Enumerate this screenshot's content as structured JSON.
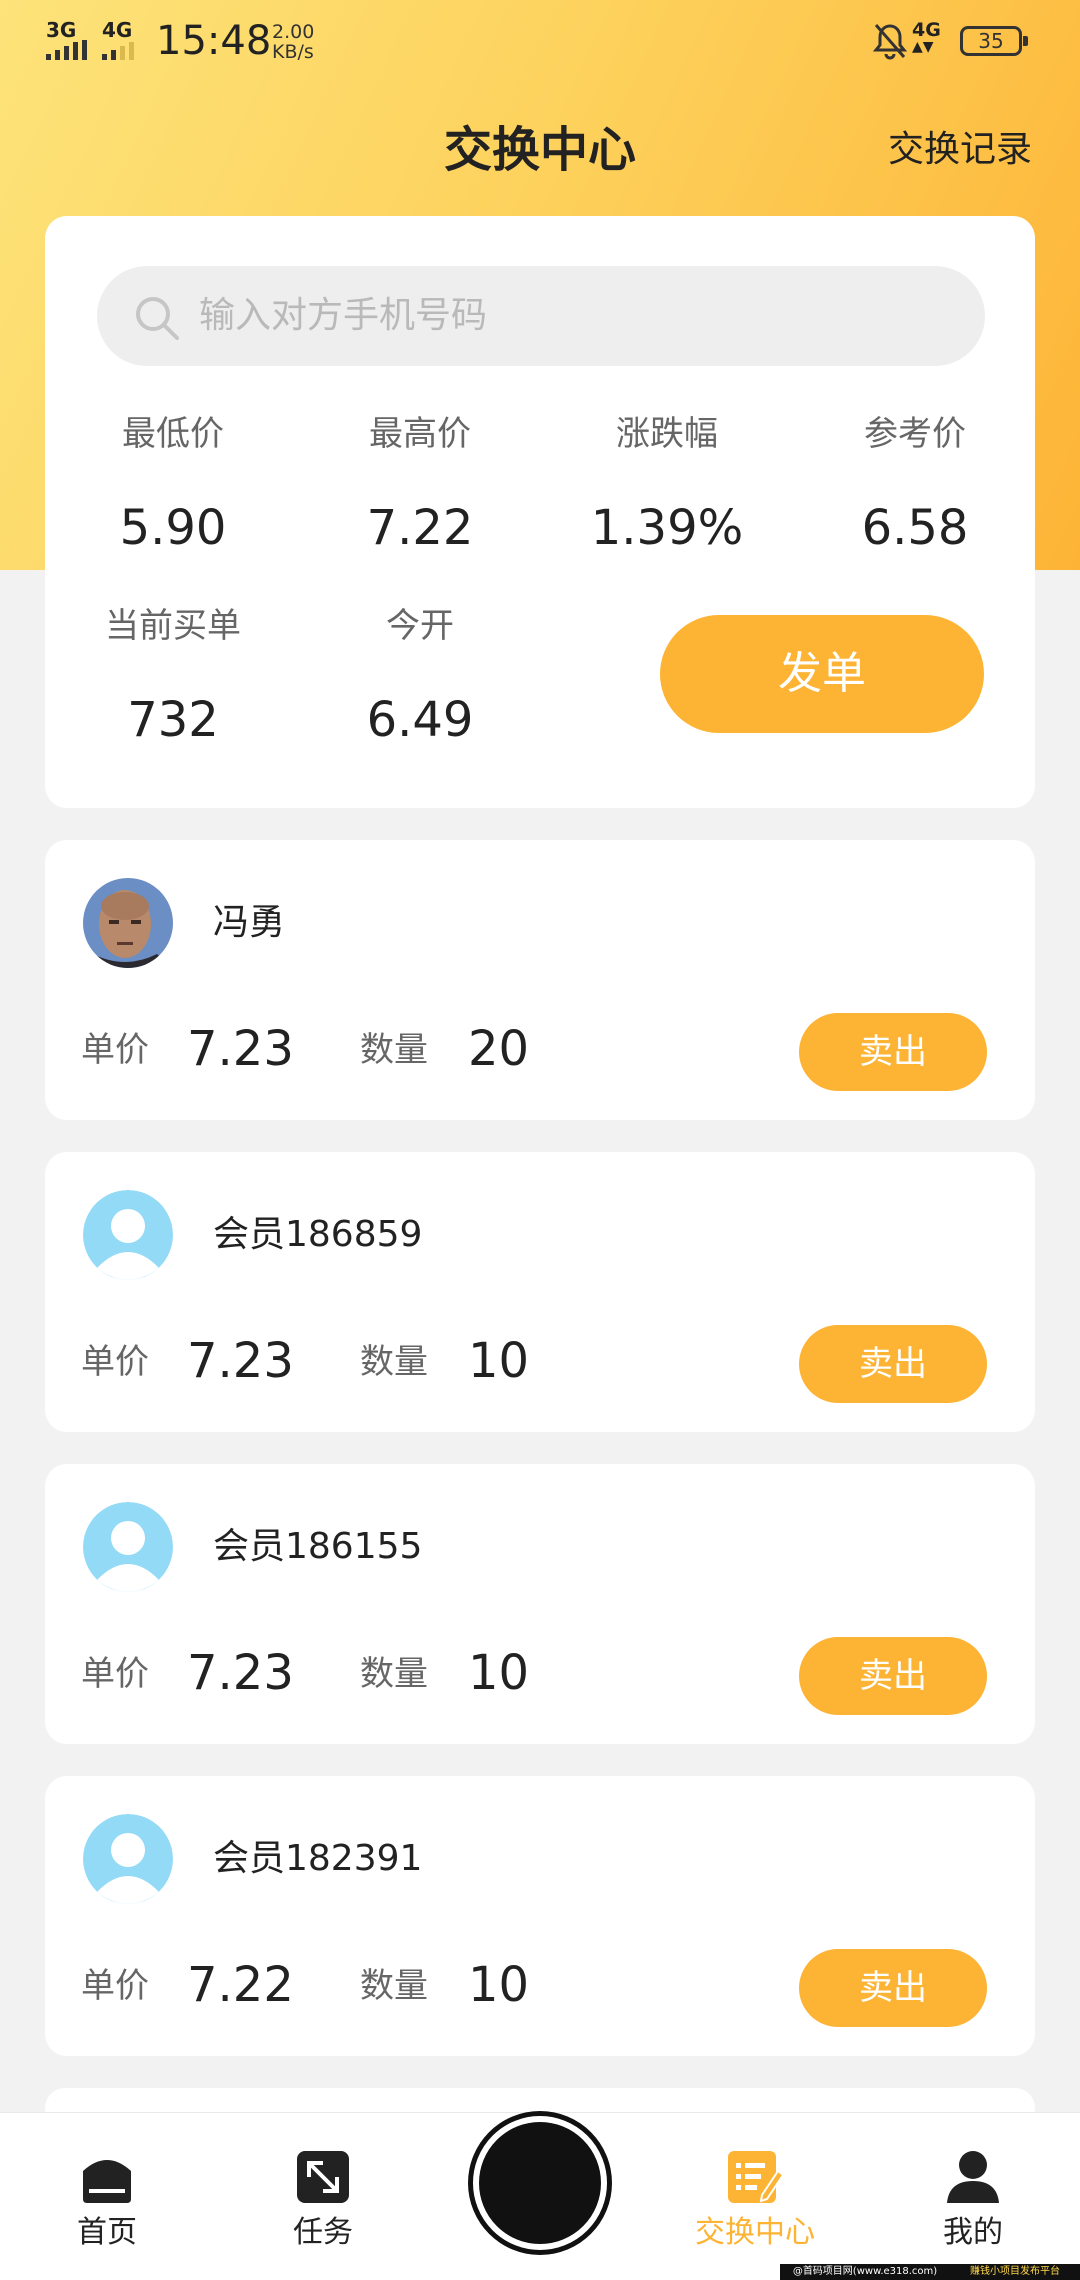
{
  "status_bar": {
    "network_1": "3G",
    "network_2": "4G",
    "time": "15:48",
    "speed_value": "2.00",
    "speed_unit": "KB/s",
    "network_3": "4G",
    "battery": "35"
  },
  "header": {
    "title": "交换中心",
    "record_link": "交换记录"
  },
  "search": {
    "placeholder": "输入对方手机号码"
  },
  "stats": [
    {
      "label": "最低价",
      "value": "5.90"
    },
    {
      "label": "最高价",
      "value": "7.22"
    },
    {
      "label": "涨跌幅",
      "value": "1.39%"
    },
    {
      "label": "参考价",
      "value": "6.58"
    },
    {
      "label": "当前买单",
      "value": "732"
    },
    {
      "label": "今开",
      "value": "6.49"
    }
  ],
  "issue_button": "发单",
  "orders": [
    {
      "name": "冯勇",
      "price_label": "单价",
      "price": "7.23",
      "qty_label": "数量",
      "qty": "20",
      "action": "卖出"
    },
    {
      "name": "会员186859",
      "price_label": "单价",
      "price": "7.23",
      "qty_label": "数量",
      "qty": "10",
      "action": "卖出"
    },
    {
      "name": "会员186155",
      "price_label": "单价",
      "price": "7.23",
      "qty_label": "数量",
      "qty": "10",
      "action": "卖出"
    },
    {
      "name": "会员182391",
      "price_label": "单价",
      "price": "7.22",
      "qty_label": "数量",
      "qty": "10",
      "action": "卖出"
    }
  ],
  "nav": {
    "tabs": [
      {
        "label": "首页",
        "icon": "home-icon"
      },
      {
        "label": "任务",
        "icon": "task-expand-icon"
      },
      {
        "label": "交换中心",
        "icon": "exchange-list-icon"
      },
      {
        "label": "我的",
        "icon": "user-icon"
      }
    ],
    "active_color": "#fdb333"
  },
  "watermark": {
    "left": "@首码项目网(www.e318.com)",
    "right": "赚钱小项目发布平台"
  },
  "colors": {
    "accent": "#fdb333",
    "hero_start": "#fde37a",
    "hero_end": "#fdb436",
    "default_avatar": "#93daf7"
  }
}
